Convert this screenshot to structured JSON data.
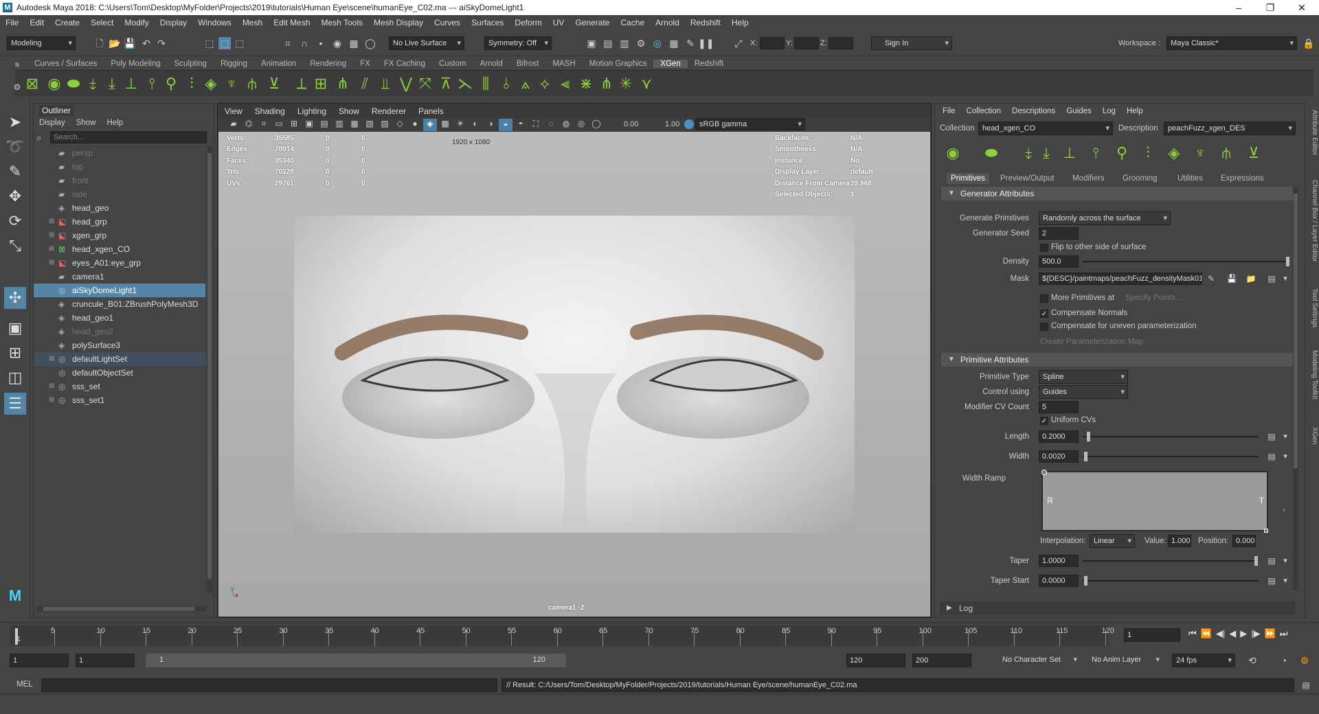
{
  "titlebar": {
    "title": "Autodesk Maya 2018: C:\\Users\\Tom\\Desktop\\MyFolder\\Projects\\2019\\tutorials\\Human Eye\\scene\\humanEye_C02.ma   ---   aiSkyDomeLight1"
  },
  "menubar": [
    "File",
    "Edit",
    "Create",
    "Select",
    "Modify",
    "Display",
    "Windows",
    "Mesh",
    "Edit Mesh",
    "Mesh Tools",
    "Mesh Display",
    "Curves",
    "Surfaces",
    "Deform",
    "UV",
    "Generate",
    "Cache",
    "Arnold",
    "Redshift",
    "Help"
  ],
  "statusline": {
    "mode": "Modeling",
    "live_surface": "No Live Surface",
    "symmetry": "Symmetry: Off",
    "x_label": "X:",
    "y_label": "Y:",
    "z_label": "Z:",
    "sign_in": "Sign In",
    "workspace_label": "Workspace :",
    "workspace_value": "Maya Classic*"
  },
  "shelf_tabs": [
    "Curves / Surfaces",
    "Poly Modeling",
    "Sculpting",
    "Rigging",
    "Animation",
    "Rendering",
    "FX",
    "FX Caching",
    "Custom",
    "Arnold",
    "Bifrost",
    "MASH",
    "Motion Graphics",
    "XGen",
    "Redshift"
  ],
  "shelf_active": "XGen",
  "outliner": {
    "title": "Outliner",
    "menu": [
      "Display",
      "Show",
      "Help"
    ],
    "search_placeholder": "Search...",
    "items": [
      {
        "label": "persp",
        "dim": true,
        "icon": "camera-icon",
        "expand": false
      },
      {
        "label": "top",
        "dim": true,
        "icon": "camera-icon",
        "expand": false
      },
      {
        "label": "front",
        "dim": true,
        "icon": "camera-icon",
        "expand": false
      },
      {
        "label": "side",
        "dim": true,
        "icon": "camera-icon",
        "expand": false
      },
      {
        "label": "head_geo",
        "dim": false,
        "icon": "mesh-icon",
        "expand": false
      },
      {
        "label": "head_grp",
        "dim": false,
        "icon": "group-icon",
        "expand": true
      },
      {
        "label": "xgen_grp",
        "dim": false,
        "icon": "group-icon",
        "expand": true
      },
      {
        "label": "head_xgen_CO",
        "dim": false,
        "icon": "xgen-icon",
        "expand": true
      },
      {
        "label": "eyes_A01:eye_grp",
        "dim": false,
        "icon": "group-icon",
        "expand": true
      },
      {
        "label": "camera1",
        "dim": false,
        "icon": "camera-icon",
        "expand": false
      },
      {
        "label": "aiSkyDomeLight1",
        "dim": false,
        "icon": "light-icon",
        "expand": false,
        "selected": true
      },
      {
        "label": "cruncule_B01:ZBrushPolyMesh3D",
        "dim": false,
        "icon": "mesh-icon",
        "expand": false
      },
      {
        "label": "head_geo1",
        "dim": false,
        "icon": "mesh-icon",
        "expand": false
      },
      {
        "label": "head_geo2",
        "dim": true,
        "icon": "mesh-icon",
        "expand": false
      },
      {
        "label": "polySurface3",
        "dim": false,
        "icon": "mesh-icon",
        "expand": false
      },
      {
        "label": "defaultLightSet",
        "dim": false,
        "icon": "set-icon",
        "expand": true,
        "highlight": true
      },
      {
        "label": "defaultObjectSet",
        "dim": false,
        "icon": "set-icon",
        "expand": false
      },
      {
        "label": "sss_set",
        "dim": false,
        "icon": "set-icon",
        "expand": true
      },
      {
        "label": "sss_set1",
        "dim": false,
        "icon": "set-icon",
        "expand": true
      }
    ]
  },
  "viewport": {
    "menu": [
      "View",
      "Shading",
      "Lighting",
      "Show",
      "Renderer",
      "Panels"
    ],
    "exposure": "0.00",
    "gamma": "1.00",
    "colorspace": "sRGB gamma",
    "resolution": "1920 x 1080",
    "camera": "camera1 -Z",
    "hud_left": [
      {
        "label": "Verts:",
        "v1": "35585",
        "v2": "0",
        "v3": "0"
      },
      {
        "label": "Edges:",
        "v1": "70914",
        "v2": "0",
        "v3": "0"
      },
      {
        "label": "Faces:",
        "v1": "35340",
        "v2": "0",
        "v3": "0"
      },
      {
        "label": "Tris:",
        "v1": "70228",
        "v2": "0",
        "v3": "0"
      },
      {
        "label": "UVs:",
        "v1": "29761",
        "v2": "0",
        "v3": "0"
      }
    ],
    "hud_right": [
      {
        "label": "Backfaces:",
        "value": "N/A"
      },
      {
        "label": "Smoothness:",
        "value": "N/A"
      },
      {
        "label": "Instance:",
        "value": "No"
      },
      {
        "label": "Display Layer:",
        "value": "default"
      },
      {
        "label": "Distance From Camera:",
        "value": "29.968"
      },
      {
        "label": "Selected Objects:",
        "value": "1"
      }
    ]
  },
  "xgen": {
    "menu": [
      "File",
      "Collection",
      "Descriptions",
      "Guides",
      "Log",
      "Help"
    ],
    "collection_label": "Collection",
    "collection_value": "head_xgen_CO",
    "description_label": "Description",
    "description_value": "peachFuzz_xgen_DES",
    "tabs": [
      "Primitives",
      "Preview/Output",
      "Modifiers",
      "Grooming",
      "Utilities",
      "Expressions"
    ],
    "active_tab": "Primitives",
    "generator": {
      "title": "Generator Attributes",
      "generate_label": "Generate Primitives",
      "generate_value": "Randomly across the surface",
      "seed_label": "Generator Seed",
      "seed_value": "2",
      "flip_label": "Flip to other side of surface",
      "flip_checked": false,
      "density_label": "Density",
      "density_value": "500.0",
      "mask_label": "Mask",
      "mask_value": "${DESC}/paintmaps/peachFuzz_densityMask01",
      "more_label": "More Primitives at",
      "more_checked": false,
      "specify_points": "Specify Points...",
      "comp_normals_label": "Compensate Normals",
      "comp_normals_checked": true,
      "comp_uneven_label": "Compensate for uneven parameterization",
      "comp_uneven_checked": false,
      "create_param_map": "Create Parameterization Map"
    },
    "primitive": {
      "title": "Primitive Attributes",
      "type_label": "Primitive Type",
      "type_value": "Spline",
      "control_label": "Control using",
      "control_value": "Guides",
      "cv_label": "Modifier CV Count",
      "cv_value": "5",
      "uniform_label": "Uniform CVs",
      "uniform_checked": true,
      "length_label": "Length",
      "length_value": "0.2000",
      "width_label": "Width",
      "width_value": "0.0020",
      "ramp_label": "Width Ramp",
      "ramp_r": "R",
      "ramp_t": "T",
      "interp_label": "Interpolation:",
      "interp_value": "Linear",
      "value_label": "Value:",
      "value_value": "1.000",
      "position_label": "Position:",
      "position_value": "0.000",
      "taper_label": "Taper",
      "taper_value": "1.0000",
      "taper_start_label": "Taper Start",
      "taper_start_value": "0.0000"
    },
    "log_label": "Log"
  },
  "side_tabs": [
    "Attribute Editor",
    "Channel Box / Layer Editor",
    "Tool Settings",
    "Modeling Toolkit",
    "XGen"
  ],
  "timeline": {
    "ticks": [
      "5",
      "10",
      "15",
      "20",
      "25",
      "30",
      "35",
      "40",
      "45",
      "50",
      "55",
      "60",
      "65",
      "70",
      "75",
      "80",
      "85",
      "90",
      "95",
      "100",
      "105",
      "110",
      "115",
      "120"
    ],
    "first_tick": "1",
    "current_frame": "1"
  },
  "range": {
    "start": "1",
    "playback_start": "1",
    "slider_start": "1",
    "slider_end": "120",
    "playback_end": "120",
    "end": "200",
    "character_set": "No Character Set",
    "anim_layer": "No Anim Layer",
    "fps": "24 fps"
  },
  "cmdline": {
    "mel_label": "MEL",
    "result": "// Result: C:/Users/Tom/Desktop/MyFolder/Projects/2019/tutorials/Human Eye/scene/humanEye_C02.ma"
  }
}
